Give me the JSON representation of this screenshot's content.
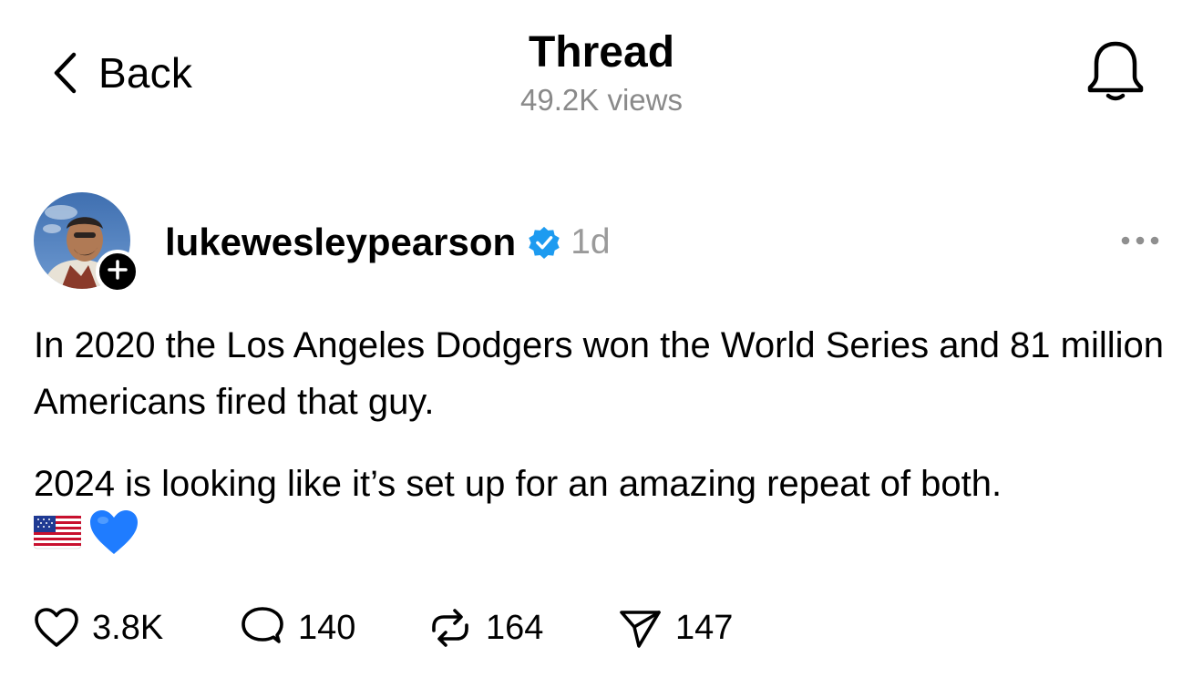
{
  "header": {
    "back_label": "Back",
    "title": "Thread",
    "views": "49.2K views"
  },
  "post": {
    "username": "lukewesleypearson",
    "verified": true,
    "timestamp": "1d",
    "paragraphs": [
      "In 2020 the Los Angeles Dodgers won the World Series and 81 million Americans fired that guy.",
      "2024 is looking like it’s set up for an amazing repeat of both."
    ],
    "emojis": [
      "flag-usa-icon",
      "blue-heart-icon"
    ]
  },
  "actions": {
    "likes": "3.8K",
    "replies": "140",
    "reposts": "164",
    "shares": "147"
  },
  "icons": {
    "back": "chevron-left-icon",
    "notifications": "bell-icon",
    "more": "more-horizontal-icon",
    "like": "heart-icon",
    "reply": "comment-icon",
    "repost": "repost-icon",
    "share": "send-icon",
    "follow": "plus-icon",
    "verified": "verified-badge-icon"
  },
  "colors": {
    "verified": "#1d9bf0",
    "secondary_text": "#8a8a8a",
    "heart_emoji": "#1f7cff"
  }
}
